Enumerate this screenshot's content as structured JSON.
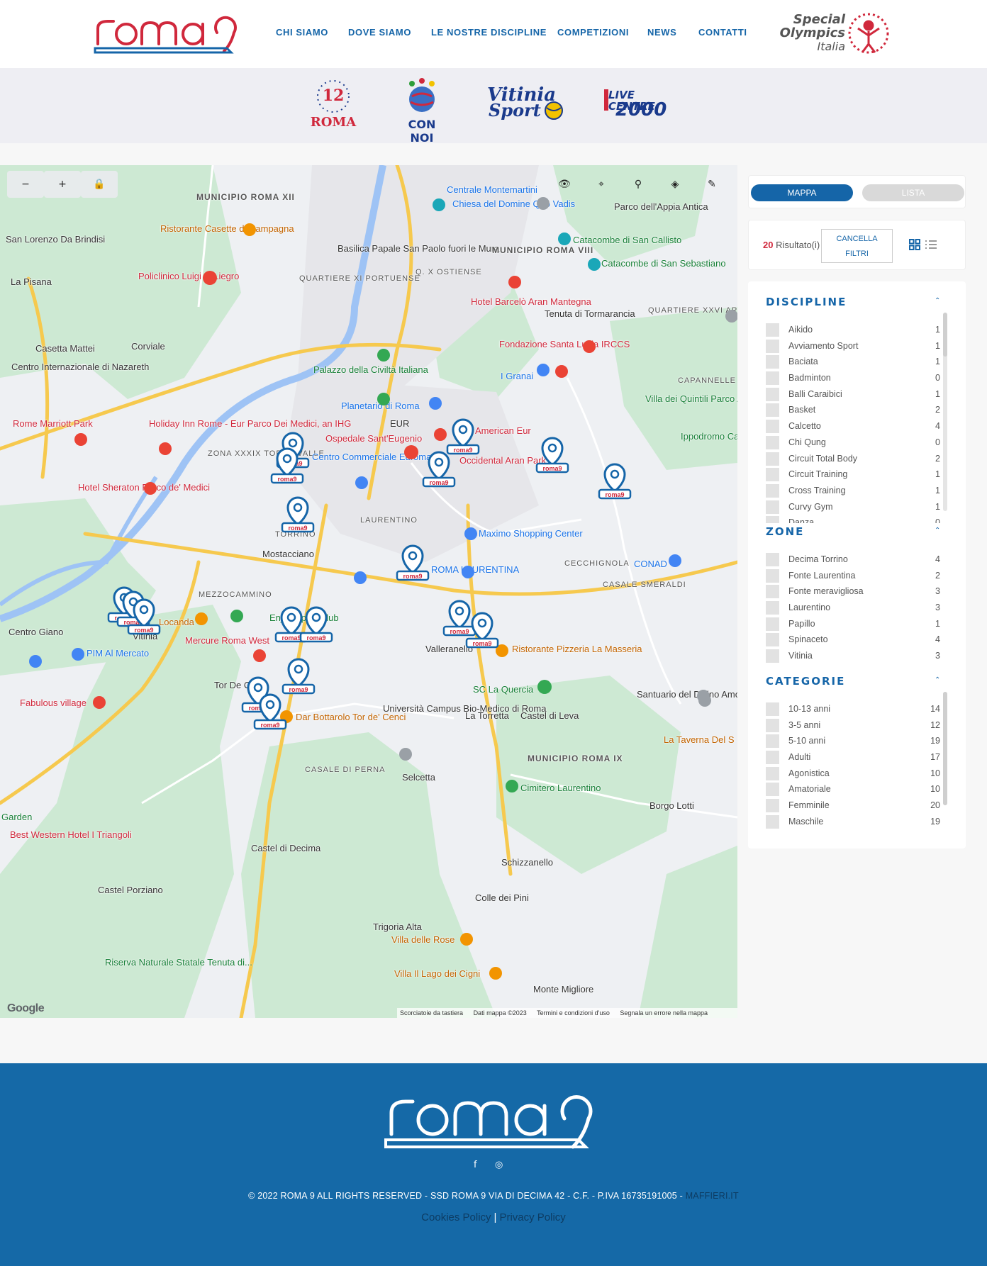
{
  "brand": {
    "name": "roma9"
  },
  "nav": {
    "items": [
      "CHI SIAMO",
      "DOVE SIAMO",
      "LE NOSTRE DISCIPLINE",
      "COMPETIZIONI",
      "NEWS",
      "CONTATTI"
    ]
  },
  "special_olympics": {
    "line1": "Special",
    "line2": "Olympics",
    "line3": "Italia"
  },
  "partners": [
    {
      "name": "12 Roma",
      "line1": "12",
      "line2": "ROMA"
    },
    {
      "name": "Con Noi",
      "line1": "CON NOI"
    },
    {
      "name": "Vitinia Sport",
      "line1": "Vitinia",
      "line2": "Sport"
    },
    {
      "name": "Live Centre 2000",
      "line1": "LIVE CENTRE",
      "line2": "2000"
    }
  ],
  "map": {
    "labels": [
      "MUNICIPIO ROMA XII",
      "San Lorenzo Da Brindisi",
      "La Pisana",
      "Ristorante Casette di Campagna",
      "Policlinico Luigi di Liegro",
      "Casetta Mattei",
      "Corviale",
      "Centro Internazionale di Nazareth",
      "Rome Marriott Park",
      "Holiday Inn Rome - Eur Parco Dei Medici, an IHG",
      "ZONA XXXIX TOR DI VALLE",
      "Hotel Sheraton Parco de' Medici",
      "Mostacciano",
      "TORRINO",
      "MEZZOCAMMINO",
      "Centro Giano",
      "Vitinia",
      "PIM Al Mercato",
      "Mercure Roma West",
      "Tor De Cenci",
      "Fabulous village",
      "Dar Bottarolo Tor de' Cenci",
      "Università Campus Bio-Medico di Roma",
      "CASALE DI PERNA",
      "Selcetta",
      "Castel di Decima",
      "Castel Porziano",
      "Riserva Naturale Statale Tenuta di...",
      "Best Western Hotel I Triangoli",
      "Centrale Montemartini",
      "Chiesa del Domine Quo Vadis",
      "Basilica Papale San Paolo fuori le Mura",
      "MUNICIPIO ROMA VIII",
      "Q. X OSTIENSE",
      "QUARTIERE XI PORTUENSE",
      "Palazzo della Civiltà Italiana",
      "Planetario di Roma",
      "Ospedale Sant'Eugenio",
      "Centro Commerciale Euroma2",
      "EUR",
      "American Eur",
      "Occidental Aran Park",
      "Hotel Barcelò Aran Mantegna",
      "Fondazione Santa Lucia IRCCS",
      "I Granai",
      "Tenuta di Tormarancia",
      "Catacombe di San Callisto",
      "Catacombe di San Sebastiano",
      "Parco dell'Appia Antica",
      "Villa dei Quintili Parco Archeologico",
      "CAPANNELLE",
      "QUARTIERE XXVI APPIO PIGNATELLI",
      "Ippodromo Capannelle",
      "LAURENTINO",
      "Maximo Shopping Center",
      "ROMA LAURENTINA",
      "CECCHIGNOLA",
      "CASALE SMERALDI",
      "CONAD",
      "Valleranello",
      "Ristorante Pizzeria La Masseria",
      "SC La Quercia",
      "La Torretta",
      "Castel di Leva",
      "Santuario del Divino Amore",
      "MUNICIPIO ROMA IX",
      "Cimitero Laurentino",
      "Borgo Lotti",
      "La Taverna Del S",
      "Schizzanello",
      "Colle dei Pini",
      "Trigoria Alta",
      "Villa delle Rose",
      "Villa Il Lago dei Cigni",
      "Monte Migliore",
      "Enjoy Sport Club",
      "Locanda",
      "Garden"
    ],
    "footer": [
      "Scorciatoie da tastiera",
      "Dati mappa ©2023",
      "Termini e condizioni d'uso",
      "Segnala un errore nella mappa"
    ],
    "google": "Google"
  },
  "view_toggle": {
    "map": "MAPPA",
    "list": "LISTA"
  },
  "results": {
    "count": "20",
    "label": "Risultato(i)",
    "clear": [
      "CANCELLA",
      "FILTRI"
    ]
  },
  "filters": {
    "discipline": {
      "title": "DISCIPLINE",
      "items": [
        [
          "Aikido",
          "1"
        ],
        [
          "Avviamento Sport",
          "1"
        ],
        [
          "Baciata",
          "1"
        ],
        [
          "Badminton",
          "0"
        ],
        [
          "Balli Caraibici",
          "1"
        ],
        [
          "Basket",
          "2"
        ],
        [
          "Calcetto",
          "4"
        ],
        [
          "Chi Qung",
          "0"
        ],
        [
          "Circuit Total Body",
          "2"
        ],
        [
          "Circuit Training",
          "1"
        ],
        [
          "Cross Training",
          "1"
        ],
        [
          "Curvy Gym",
          "1"
        ],
        [
          "Danza",
          "0"
        ]
      ]
    },
    "zone": {
      "title": "ZONE",
      "items": [
        [
          "Decima Torrino",
          "4"
        ],
        [
          "Fonte Laurentina",
          "2"
        ],
        [
          "Fonte meravigliosa",
          "3"
        ],
        [
          "Laurentino",
          "3"
        ],
        [
          "Papillo",
          "1"
        ],
        [
          "Spinaceto",
          "4"
        ],
        [
          "Vitinia",
          "3"
        ]
      ]
    },
    "categorie": {
      "title": "CATEGORIE",
      "items": [
        [
          "10-13 anni",
          "14"
        ],
        [
          "3-5 anni",
          "12"
        ],
        [
          "5-10 anni",
          "19"
        ],
        [
          "Adulti",
          "17"
        ],
        [
          "Agonistica",
          "10"
        ],
        [
          "Amatoriale",
          "10"
        ],
        [
          "Femminile",
          "20"
        ],
        [
          "Maschile",
          "19"
        ]
      ]
    }
  },
  "footer": {
    "copyright": "© 2022 ROMA 9 ALL RIGHTS RESERVED - SSD ROMA 9 VIA DI DECIMA 42 - C.F. - P.IVA 16735191005 -",
    "credit": "MAFFIERI.IT",
    "cookies": "Cookies Policy",
    "privacy": "Privacy Policy",
    "separator": "|"
  },
  "colors": {
    "brand_blue": "#1565a8",
    "brand_red": "#d0283c",
    "footer_blue": "#1569a7"
  }
}
